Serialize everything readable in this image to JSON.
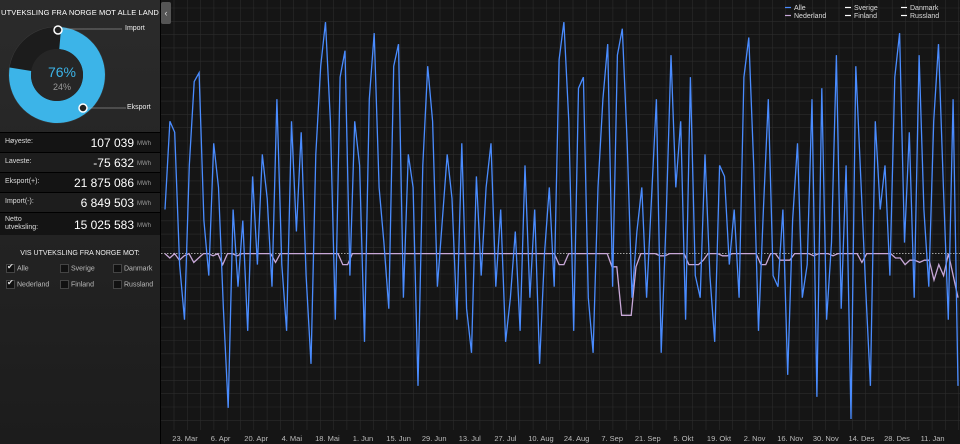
{
  "sidebar": {
    "title": "UTVEKSLING FRA NORGE MOT ALLE LAND",
    "donut": {
      "export_percent": 76,
      "import_percent": 24,
      "export_display": "76%",
      "import_display": "24%",
      "import_label": "Import",
      "export_label": "Eksport",
      "colors": {
        "export": "#3cb4e8",
        "import": "#1c1c1c"
      }
    },
    "stats": [
      {
        "label": "Høyeste:",
        "value": "107 039",
        "unit": "MWh"
      },
      {
        "label": "Laveste:",
        "value": "-75 632",
        "unit": "MWh"
      },
      {
        "label": "Eksport(+):",
        "value": "21 875 086",
        "unit": "MWh"
      },
      {
        "label": "Import(-):",
        "value": "6 849 503",
        "unit": "MWh"
      },
      {
        "label": "Netto utveksling:",
        "value": "15 025 583",
        "unit": "MWh"
      }
    ],
    "vis_title": "VIS UTVEKSLING FRA NORGE MOT:",
    "checkboxes": [
      {
        "label": "Alle",
        "checked": true
      },
      {
        "label": "Sverige",
        "checked": false
      },
      {
        "label": "Danmark",
        "checked": false
      },
      {
        "label": "Nederland",
        "checked": true
      },
      {
        "label": "Finland",
        "checked": false
      },
      {
        "label": "Russland",
        "checked": false
      }
    ]
  },
  "toggle_icon": "chevron-left-icon",
  "chart_data": {
    "type": "line",
    "grid": true,
    "legend_position": "top-right",
    "x_tick_labels": [
      "23. Mar",
      "6. Apr",
      "20. Apr",
      "4. Mai",
      "18. Mai",
      "1. Jun",
      "15. Jun",
      "29. Jun",
      "13. Jul",
      "27. Jul",
      "10. Aug",
      "24. Aug",
      "7. Sep",
      "21. Sep",
      "5. Okt",
      "19. Okt",
      "2. Nov",
      "16. Nov",
      "30. Nov",
      "14. Des",
      "28. Des",
      "11. Jan"
    ],
    "ylim": [
      -80000,
      115000
    ],
    "series": [
      {
        "name": "Alle",
        "color": "#4a8cff",
        "values": [
          20000,
          60000,
          55000,
          -5000,
          -30000,
          40000,
          78000,
          82000,
          15000,
          -10000,
          50000,
          30000,
          -25000,
          -70000,
          20000,
          -15000,
          15000,
          -35000,
          35000,
          -5000,
          45000,
          25000,
          -15000,
          70000,
          -5000,
          -35000,
          60000,
          10000,
          55000,
          -10000,
          -50000,
          45000,
          85000,
          105000,
          60000,
          -30000,
          80000,
          92000,
          -10000,
          60000,
          40000,
          -40000,
          70000,
          100000,
          30000,
          5000,
          -25000,
          85000,
          95000,
          -20000,
          45000,
          30000,
          -60000,
          40000,
          85000,
          60000,
          -15000,
          15000,
          45000,
          25000,
          -30000,
          50000,
          -25000,
          -45000,
          35000,
          -10000,
          30000,
          50000,
          -15000,
          20000,
          -40000,
          -20000,
          10000,
          -35000,
          40000,
          -20000,
          20000,
          -50000,
          0,
          30000,
          -15000,
          88000,
          105000,
          60000,
          -35000,
          75000,
          80000,
          -20000,
          -45000,
          30000,
          70000,
          95000,
          -15000,
          90000,
          102000,
          50000,
          -20000,
          10000,
          30000,
          -20000,
          25000,
          70000,
          -45000,
          15000,
          90000,
          30000,
          60000,
          -30000,
          80000,
          -10000,
          -20000,
          45000,
          -10000,
          -40000,
          40000,
          35000,
          -5000,
          20000,
          -20000,
          80000,
          98000,
          40000,
          -35000,
          20000,
          70000,
          -10000,
          -15000,
          20000,
          -55000,
          15000,
          50000,
          -20000,
          -5000,
          70000,
          -65000,
          75000,
          -30000,
          5000,
          90000,
          -25000,
          40000,
          -75000,
          85000,
          35000,
          -15000,
          -60000,
          60000,
          20000,
          40000,
          -10000,
          80000,
          100000,
          5000,
          55000,
          -20000,
          90000,
          20000,
          -15000,
          60000,
          95000,
          30000,
          -30000,
          70000,
          -60000
        ]
      },
      {
        "name": "Nederland",
        "color": "#c8a8d8",
        "values": [
          0,
          -2000,
          0,
          -3000,
          -1000,
          0,
          -4000,
          -2000,
          0,
          0,
          -1000,
          0,
          -5000,
          0,
          0,
          -1000,
          0,
          0,
          0,
          0,
          0,
          0,
          0,
          -4000,
          0,
          0,
          0,
          0,
          0,
          0,
          0,
          0,
          0,
          0,
          0,
          0,
          0,
          -5000,
          -5000,
          0,
          0,
          0,
          0,
          0,
          0,
          0,
          0,
          0,
          0,
          0,
          0,
          0,
          0,
          0,
          0,
          0,
          0,
          0,
          0,
          0,
          0,
          0,
          0,
          0,
          0,
          0,
          0,
          0,
          0,
          0,
          0,
          0,
          0,
          0,
          0,
          0,
          0,
          0,
          0,
          0,
          0,
          0,
          -5000,
          -5000,
          0,
          0,
          0,
          0,
          0,
          0,
          0,
          0,
          0,
          -6000,
          -6000,
          -28000,
          -28000,
          -28000,
          -6000,
          0,
          0,
          0,
          0,
          -1000,
          -1000,
          0,
          0,
          0,
          0,
          -5000,
          -5000,
          -5000,
          -3000,
          0,
          0,
          0,
          -1000,
          -1000,
          0,
          0,
          0,
          0,
          0,
          0,
          -5000,
          -5000,
          0,
          0,
          -3000,
          -3000,
          -3000,
          0,
          0,
          0,
          0,
          -1000,
          0,
          0,
          0,
          -1000,
          0,
          0,
          0,
          0,
          0,
          -4000,
          0,
          0,
          0,
          0,
          0,
          0,
          -2000,
          -2000,
          -5000,
          -3000,
          -3000,
          -4000,
          -3000,
          -3000,
          -12000,
          -5000,
          -10000,
          0,
          -10000,
          -20000
        ]
      }
    ],
    "legend": [
      "Alle",
      "Nederland",
      "Sverige",
      "Finland",
      "Danmark",
      "Russland"
    ],
    "legend_colors": [
      "#4a8cff",
      "#c8a8d8",
      "#ffffff",
      "#ffffff",
      "#ffffff",
      "#ffffff"
    ]
  }
}
